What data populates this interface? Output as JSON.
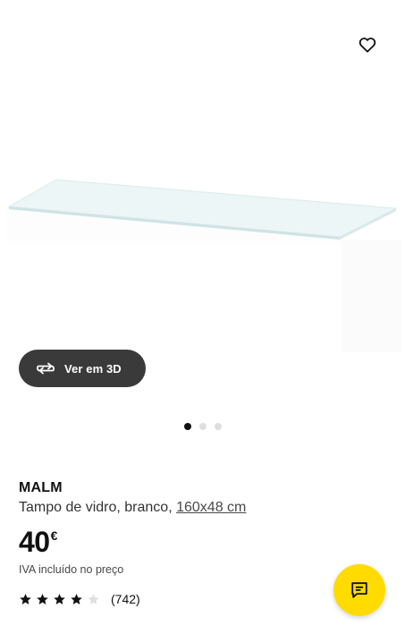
{
  "gallery": {
    "view_3d_label": "Ver em 3D",
    "slides": 3,
    "active_slide": 1
  },
  "product": {
    "name": "MALM",
    "description": "Tampo de vidro, branco,",
    "measurement": "160x48 cm",
    "price_amount": "40",
    "price_currency": "€",
    "vat_note": "IVA incluído no preço"
  },
  "rating": {
    "stars": 4,
    "max_stars": 5,
    "review_count": "(742)"
  },
  "icons": {
    "favorite": "heart-icon",
    "view_3d": "rotate-icon",
    "chat": "chat-icon"
  },
  "colors": {
    "view_3d_bg": "#3a3a3a",
    "chat_bg": "#ffdb00",
    "dot_active": "#111111",
    "dot_inactive": "#dfdfdf"
  }
}
